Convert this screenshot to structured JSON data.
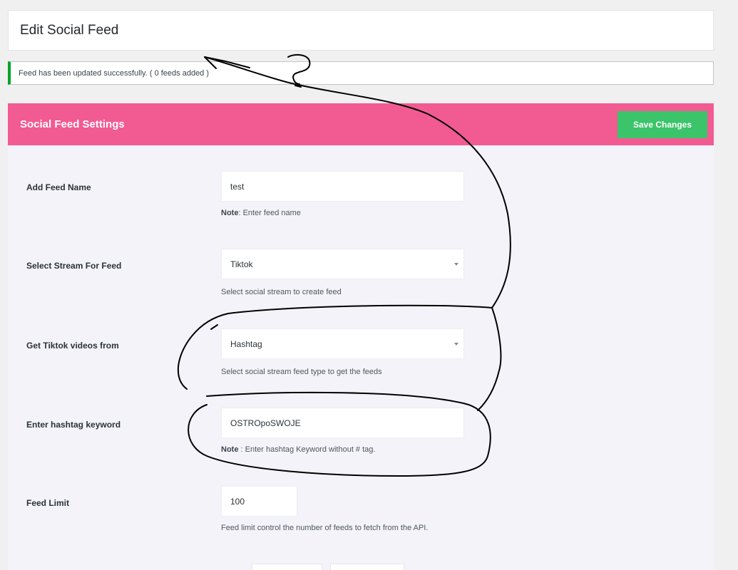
{
  "header": {
    "title": "Edit Social Feed"
  },
  "notice": {
    "text": "Feed has been updated successfully. ( 0 feeds added )",
    "color": "#00a32a"
  },
  "settings": {
    "title": "Social Feed Settings",
    "save_label": "Save Changes",
    "accent": "#f25b92",
    "save_color": "#3cc46a"
  },
  "form": {
    "feed_name": {
      "label": "Add Feed Name",
      "value": "test",
      "note_bold": "Note",
      "note": ": Enter feed name"
    },
    "stream": {
      "label": "Select Stream For Feed",
      "value": "Tiktok",
      "hint": "Select social stream to create feed"
    },
    "source": {
      "label": "Get Tiktok videos from",
      "value": "Hashtag",
      "hint": "Select social stream feed type to get the feeds"
    },
    "hashtag": {
      "label": "Enter hashtag keyword",
      "value": "OSTROpoSWOJE",
      "note_bold": "Note",
      "note": " : Enter hashtag Keyword without # tag."
    },
    "limit": {
      "label": "Feed Limit",
      "value": "100",
      "hint": "Feed limit control the number of feeds to fetch from the API."
    }
  }
}
